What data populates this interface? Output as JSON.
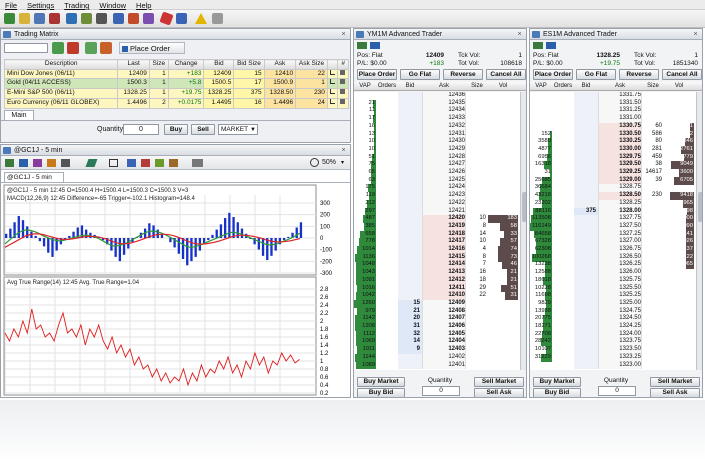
{
  "menu": [
    "File",
    "Settings",
    "Trading",
    "Window",
    "Help"
  ],
  "toolbar_icons": [
    "connection-icon",
    "order-icon",
    "account-icon",
    "chart-icon",
    "dom-icon",
    "matrix-icon",
    "news-icon",
    "link-icon",
    "alert-icon",
    "options-icon"
  ],
  "trading_matrix": {
    "title": "Trading Matrix",
    "place_order": "Place Order",
    "columns": [
      "Description",
      "Last",
      "Size",
      "Change",
      "Bid",
      "Bid Size",
      "Ask",
      "Ask Size",
      "",
      "#"
    ],
    "rows": [
      [
        "Mini Dow Jones (06/11)",
        "12409",
        "1",
        "+183",
        "12409",
        "15",
        "12410",
        "22"
      ],
      [
        "Gold (04/11 ACCESS)",
        "1500.3",
        "1",
        "+5.8",
        "1500.5",
        "17",
        "1500.9",
        "1"
      ],
      [
        "E-Mini S&P 500 (06/11)",
        "1328.25",
        "1",
        "+19.75",
        "1328.25",
        "375",
        "1328.50",
        "230"
      ],
      [
        "Euro Currency (06/11 GLOBEX)",
        "1.4496",
        "2",
        "+0.0175",
        "1.4495",
        "16",
        "1.4496",
        "24"
      ]
    ],
    "tab": "Main",
    "quantity_label": "Quantity",
    "quantity": "0",
    "buy": "Buy",
    "sell": "Sell",
    "order_type": "MARKET"
  },
  "chart": {
    "title": "@GC1J - 5 min",
    "tab": "@GC1J - 5 min",
    "zoom": "50%",
    "header": "@GC1J - 5 min 12:45 O=1500.4 H=1500.4 L=1500.3 C=1500.3 V=3",
    "macd_label": "MACD(12,26,9) 12:45 Difference=-65 Trigger=-102.1 Histogram=148.4",
    "atr_label": "Avg True Range(14) 12:45 Avg. True Range=1.04",
    "macd_ticks": [
      "300",
      "200",
      "100",
      "0",
      "-100",
      "-200",
      "-300"
    ],
    "atr_ticks": [
      "2.8",
      "2.6",
      "2.4",
      "2.2",
      "2",
      "1.8",
      "1.6",
      "1.4",
      "1.2",
      "1",
      "0.8",
      "0.6",
      "0.4",
      "0.2"
    ]
  },
  "chart_data": [
    {
      "type": "bar",
      "title": "MACD(12,26,9) 12:45 Difference=-65 Trigger=-102.1 Histogram=148.4",
      "ylim": [
        -300,
        300
      ],
      "histogram": [
        40,
        90,
        150,
        210,
        170,
        110,
        60,
        20,
        -30,
        -80,
        -140,
        -180,
        -120,
        -60,
        -10,
        20,
        60,
        100,
        120,
        80,
        50,
        30,
        10,
        -20,
        -60,
        -120,
        -180,
        -220,
        -160,
        -100,
        -40,
        10,
        50,
        90,
        140,
        120,
        80,
        40,
        0,
        -40,
        -90,
        -150,
        -200,
        -260,
        -220,
        -180,
        -120,
        -60,
        -20,
        30,
        80,
        130,
        190,
        240,
        200,
        150,
        90,
        40,
        -10,
        -60,
        -110,
        -170,
        -210,
        -170,
        -120,
        -60,
        -20,
        10,
        50,
        100,
        150
      ],
      "macd": [
        -50,
        -20,
        10,
        40,
        60,
        70,
        65,
        55,
        40,
        20,
        5,
        -10,
        -20,
        -25,
        -20,
        -10,
        0,
        10,
        20,
        25,
        20,
        10,
        0,
        -20,
        -40,
        -60,
        -70,
        -65,
        -55,
        -40,
        -20,
        0,
        20,
        40,
        55,
        60,
        55,
        45,
        30,
        10,
        -10,
        -30,
        -50,
        -70,
        -80,
        -75,
        -65,
        -50,
        -35,
        -20,
        -5,
        10,
        25,
        40,
        50,
        45,
        35,
        20,
        5,
        -10,
        -25,
        -40,
        -55,
        -60,
        -55,
        -45,
        -30,
        -15,
        0,
        20,
        40
      ],
      "trigger": [
        -80,
        -60,
        -40,
        -20,
        0,
        20,
        30,
        35,
        35,
        30,
        20,
        10,
        0,
        -8,
        -12,
        -12,
        -8,
        -2,
        5,
        12,
        15,
        14,
        10,
        2,
        -8,
        -22,
        -36,
        -46,
        -50,
        -48,
        -42,
        -32,
        -20,
        -6,
        8,
        20,
        28,
        32,
        32,
        28,
        20,
        8,
        -6,
        -22,
        -36,
        -46,
        -52,
        -52,
        -48,
        -42,
        -34,
        -24,
        -12,
        0,
        12,
        20,
        24,
        24,
        20,
        14,
        6,
        -4,
        -16,
        -26,
        -32,
        -34,
        -32,
        -28,
        -22,
        -14,
        -4
      ]
    },
    {
      "type": "line",
      "title": "Avg True Range(14) 12:45 Avg. True Range=1.04",
      "ylim": [
        0.2,
        2.8
      ],
      "values": [
        1.7,
        1.5,
        1.8,
        1.6,
        2.0,
        1.7,
        2.3,
        1.8,
        1.9,
        1.6,
        1.7,
        1.5,
        1.9,
        2.2,
        1.7,
        1.8,
        1.6,
        1.9,
        1.4,
        1.8,
        1.6,
        1.9,
        1.5,
        1.3,
        1.6,
        1.2,
        1.4,
        1.1,
        1.3,
        0.9,
        1.1,
        0.8,
        0.9,
        0.6,
        0.8,
        0.5,
        0.7,
        0.45,
        0.6,
        0.5,
        0.8,
        0.4,
        0.7,
        0.5,
        0.9,
        0.6,
        0.8,
        0.7,
        1.0,
        0.8,
        1.1,
        0.7,
        0.9,
        0.6,
        1.0,
        0.8,
        1.2,
        0.9,
        1.1,
        0.7,
        1.0,
        0.9,
        1.2,
        1.0,
        1.15,
        0.95,
        1.04
      ]
    }
  ],
  "dom_left": {
    "title": "YM1M Advanced Trader",
    "pos": "Pos: Flat",
    "pl": "P/L: $0.00",
    "last": "12409",
    "change": "+183",
    "tck_vol_label": "Tck Vol:",
    "tck_vol": "1",
    "tot_vol_label": "Tot Vol:",
    "tot_vol": "108618",
    "buttons": [
      "Place Order",
      "Go Flat",
      "Reverse",
      "Cancel All"
    ],
    "columns": [
      "VAP",
      "Orders",
      "Bid",
      "Ask",
      "Size",
      "Vol"
    ],
    "rows": [
      {
        "vap": "",
        "bid": "",
        "price": "12436",
        "ask": "",
        "vol": ""
      },
      {
        "vap": "21",
        "bid": "",
        "price": "12435",
        "ask": "",
        "vol": ""
      },
      {
        "vap": "11",
        "bid": "",
        "price": "12434",
        "ask": "",
        "vol": ""
      },
      {
        "vap": "17",
        "bid": "",
        "price": "12433",
        "ask": "",
        "vol": ""
      },
      {
        "vap": "16",
        "bid": "",
        "price": "12432",
        "ask": "",
        "vol": ""
      },
      {
        "vap": "13",
        "bid": "",
        "price": "12431",
        "ask": "",
        "vol": ""
      },
      {
        "vap": "10",
        "bid": "",
        "price": "12430",
        "ask": "",
        "vol": ""
      },
      {
        "vap": "10",
        "bid": "",
        "price": "12429",
        "ask": "",
        "vol": ""
      },
      {
        "vap": "51",
        "bid": "",
        "price": "12428",
        "ask": "",
        "vol": ""
      },
      {
        "vap": "75",
        "bid": "",
        "price": "12427",
        "ask": "",
        "vol": ""
      },
      {
        "vap": "65",
        "bid": "",
        "price": "12426",
        "ask": "",
        "vol": ""
      },
      {
        "vap": "63",
        "bid": "",
        "price": "12425",
        "ask": "",
        "vol": ""
      },
      {
        "vap": "175",
        "bid": "",
        "price": "12424",
        "ask": "",
        "vol": ""
      },
      {
        "vap": "119",
        "bid": "",
        "price": "12423",
        "ask": "",
        "vol": ""
      },
      {
        "vap": "212",
        "bid": "",
        "price": "12422",
        "ask": "",
        "vol": ""
      },
      {
        "vap": "297",
        "bid": "",
        "price": "12421",
        "ask": "",
        "vol": ""
      },
      {
        "vap": "487",
        "bid": "",
        "price": "12420",
        "ask": "10",
        "vol": "183"
      },
      {
        "vap": "385",
        "bid": "",
        "price": "12419",
        "ask": "8",
        "vol": "58"
      },
      {
        "vap": "658",
        "bid": "",
        "price": "12418",
        "ask": "14",
        "vol": "33"
      },
      {
        "vap": "778",
        "bid": "",
        "price": "12417",
        "ask": "10",
        "vol": "57"
      },
      {
        "vap": "1014",
        "bid": "",
        "price": "12416",
        "ask": "4",
        "vol": "74"
      },
      {
        "vap": "1136",
        "bid": "",
        "price": "12415",
        "ask": "8",
        "vol": "73"
      },
      {
        "vap": "1048",
        "bid": "",
        "price": "12414",
        "ask": "7",
        "vol": "46"
      },
      {
        "vap": "1043",
        "bid": "",
        "price": "12413",
        "ask": "16",
        "vol": "21"
      },
      {
        "vap": "1091",
        "bid": "",
        "price": "12412",
        "ask": "18",
        "vol": "21"
      },
      {
        "vap": "1016",
        "bid": "",
        "price": "12411",
        "ask": "29",
        "vol": "51"
      },
      {
        "vap": "1042",
        "bid": "",
        "price": "12410",
        "ask": "22",
        "vol": "31"
      },
      {
        "vap": "1260",
        "bid": "15",
        "price": "12409",
        "ask": "",
        "vol": ""
      },
      {
        "vap": "979",
        "bid": "21",
        "price": "12408",
        "ask": "",
        "vol": ""
      },
      {
        "vap": "1142",
        "bid": "20",
        "price": "12407",
        "ask": "",
        "vol": ""
      },
      {
        "vap": "1208",
        "bid": "31",
        "price": "12406",
        "ask": "",
        "vol": ""
      },
      {
        "vap": "1112",
        "bid": "32",
        "price": "12405",
        "ask": "",
        "vol": ""
      },
      {
        "vap": "1069",
        "bid": "14",
        "price": "12404",
        "ask": "",
        "vol": ""
      },
      {
        "vap": "1011",
        "bid": "9",
        "price": "12403",
        "ask": "",
        "vol": ""
      },
      {
        "vap": "1144",
        "bid": "",
        "price": "12402",
        "ask": "",
        "vol": ""
      },
      {
        "vap": "1089",
        "bid": "",
        "price": "12401",
        "ask": "",
        "vol": ""
      }
    ],
    "buy_market": "Buy Market",
    "sell_market": "Sell Market",
    "buy_bid": "Buy Bid",
    "sell_ask": "Sell Ask",
    "quantity_label": "Quantity",
    "quantity": "0"
  },
  "dom_right": {
    "title": "ES1M Advanced Trader",
    "pos": "Pos: Flat",
    "pl": "P/L: $0.00",
    "last": "1328.25",
    "change": "+19.75",
    "tck_vol_label": "Tck Vol:",
    "tck_vol": "1",
    "tot_vol_label": "Tot Vol:",
    "tot_vol": "1851340",
    "buttons": [
      "Place Order",
      "Go Flat",
      "Reverse",
      "Cancel All"
    ],
    "columns": [
      "VAP",
      "Orders",
      "Bid",
      "Ask",
      "Size",
      "Vol"
    ],
    "rows": [
      {
        "vap": "",
        "bid": "",
        "price": "1331.75",
        "ask": "",
        "vol": ""
      },
      {
        "vap": "",
        "bid": "",
        "price": "1331.50",
        "ask": "",
        "vol": ""
      },
      {
        "vap": "",
        "bid": "",
        "price": "1331.25",
        "ask": "",
        "vol": ""
      },
      {
        "vap": "",
        "bid": "",
        "price": "1331.00",
        "ask": "",
        "vol": ""
      },
      {
        "vap": "",
        "bid": "",
        "price": "1330.75",
        "ask": "60",
        "vol": "21"
      },
      {
        "vap": "152",
        "bid": "",
        "price": "1330.50",
        "ask": "586",
        "vol": "182"
      },
      {
        "vap": "3580",
        "bid": "",
        "price": "1330.25",
        "ask": "80",
        "vol": "1346"
      },
      {
        "vap": "4877",
        "bid": "",
        "price": "1330.00",
        "ask": "281",
        "vol": "2761"
      },
      {
        "vap": "6956",
        "bid": "",
        "price": "1329.75",
        "ask": "459",
        "vol": "1779"
      },
      {
        "vap": "16318",
        "bid": "",
        "price": "1329.50",
        "ask": "38",
        "vol": "9049"
      },
      {
        "vap": "31",
        "bid": "",
        "price": "1329.25",
        "ask": "14617",
        "vol": "3600"
      },
      {
        "vap": "25685",
        "bid": "",
        "price": "1329.00",
        "ask": "39",
        "vol": "6705"
      },
      {
        "vap": "36684",
        "bid": "",
        "price": "1328.75",
        "ask": "",
        "vol": ""
      },
      {
        "vap": "43218",
        "bid": "",
        "price": "1328.50",
        "ask": "230",
        "vol": "9418"
      },
      {
        "vap": "23202",
        "bid": "",
        "price": "1328.25",
        "ask": "",
        "vol": "1965"
      },
      {
        "vap": "88116",
        "bid": "375",
        "price": "1328.00",
        "ask": "",
        "vol": "898"
      },
      {
        "vap": "113508",
        "bid": "",
        "price": "1327.75",
        "ask": "",
        "vol": "1000"
      },
      {
        "vap": "116149",
        "bid": "",
        "price": "1327.50",
        "ask": "",
        "vol": "1090"
      },
      {
        "vap": "84658",
        "bid": "",
        "price": "1327.25",
        "ask": "",
        "vol": "1141"
      },
      {
        "vap": "67328",
        "bid": "",
        "price": "1327.00",
        "ask": "",
        "vol": "1026"
      },
      {
        "vap": "62308",
        "bid": "",
        "price": "1326.75",
        "ask": "",
        "vol": "1137"
      },
      {
        "vap": "100268",
        "bid": "",
        "price": "1326.50",
        "ask": "",
        "vol": "1122"
      },
      {
        "vap": "13238",
        "bid": "",
        "price": "1326.25",
        "ask": "",
        "vol": "1065"
      },
      {
        "vap": "12588",
        "bid": "",
        "price": "1326.00",
        "ask": "",
        "vol": ""
      },
      {
        "vap": "18618",
        "bid": "",
        "price": "1325.75",
        "ask": "",
        "vol": ""
      },
      {
        "vap": "10228",
        "bid": "",
        "price": "1325.50",
        "ask": "",
        "vol": ""
      },
      {
        "vap": "11698",
        "bid": "",
        "price": "1325.25",
        "ask": "",
        "vol": ""
      },
      {
        "vap": "9829",
        "bid": "",
        "price": "1325.00",
        "ask": "",
        "vol": ""
      },
      {
        "vap": "13938",
        "bid": "",
        "price": "1324.75",
        "ask": "",
        "vol": ""
      },
      {
        "vap": "20775",
        "bid": "",
        "price": "1324.50",
        "ask": "",
        "vol": ""
      },
      {
        "vap": "18271",
        "bid": "",
        "price": "1324.25",
        "ask": "",
        "vol": ""
      },
      {
        "vap": "22708",
        "bid": "",
        "price": "1324.00",
        "ask": "",
        "vol": ""
      },
      {
        "vap": "28242",
        "bid": "",
        "price": "1323.75",
        "ask": "",
        "vol": ""
      },
      {
        "vap": "10107",
        "bid": "",
        "price": "1323.50",
        "ask": "",
        "vol": ""
      },
      {
        "vap": "31229",
        "bid": "",
        "price": "1323.25",
        "ask": "",
        "vol": ""
      },
      {
        "vap": "",
        "bid": "",
        "price": "1323.00",
        "ask": "",
        "vol": ""
      }
    ],
    "buy_market": "Buy Market",
    "sell_market": "Sell Market",
    "buy_bid": "Buy Bid",
    "sell_ask": "Sell Ask",
    "quantity_label": "Quantity",
    "quantity": "0"
  }
}
